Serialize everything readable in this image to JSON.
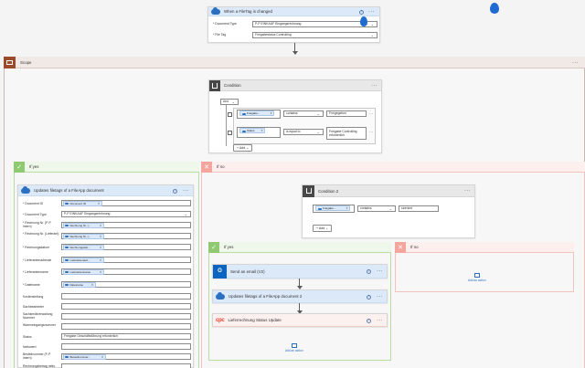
{
  "trigger": {
    "title": "When a FileTag is changed",
    "fields": [
      {
        "label": "* Document Type",
        "value": "P-P EINKAUF Eingangsrechnung"
      },
      {
        "label": "* File Tag",
        "value": "Freigabestatus Controlling"
      }
    ]
  },
  "scope": {
    "title": "Scope"
  },
  "condition": {
    "title": "Condition",
    "group_operator": "And",
    "rows": [
      {
        "token": "Freigabe...",
        "operator": "contains",
        "value": "Freigegeben"
      },
      {
        "token": "Status",
        "operator": "is equal to",
        "value": "Freigabe Controlling erforderlich"
      }
    ],
    "add_label": "Add"
  },
  "if_yes": {
    "title": "If yes",
    "update_card": {
      "title": "Updates filetags of a FileApp document",
      "fields": [
        {
          "label": "* Document ID",
          "token": "Document ID"
        },
        {
          "label": "* Document Type",
          "value": "P-P EINKAUF Eingangsrechnung"
        },
        {
          "label": "* Rechnung Nr. (P-P intern)",
          "token": "Rechnung Nr. (..."
        },
        {
          "label": "* Rechnung Nr. (Lieferant)",
          "token": "Rechnung Nr. (..."
        },
        {
          "label": "* Rechnungsdatum",
          "token": "Rechnungsdat..."
        },
        {
          "label": "* Lieferantenadresse",
          "token": "Lieferantenadr..."
        },
        {
          "label": "* Lieferantenname",
          "token": "Lieferantenname"
        },
        {
          "label": "* Dateiname",
          "token": "Dateiname"
        },
        {
          "label": "Kostenstellung",
          "value": ""
        },
        {
          "label": "Sachbearbeiter",
          "value": ""
        },
        {
          "label": "Sachkreditverwaltung Nummer",
          "value": ""
        },
        {
          "label": "Wareneingangsnummer",
          "value": ""
        },
        {
          "label": "Status",
          "value": "Freigabe Geschäftsführung erforderlich"
        },
        {
          "label": "Nettowert",
          "value": ""
        },
        {
          "label": "Bestellnummer (P-P intern)",
          "token": "Bestellnummer..."
        },
        {
          "label": "Rechnungsbetrag netto",
          "value": ""
        }
      ]
    }
  },
  "if_no": {
    "title": "If no",
    "condition2": {
      "title": "Condition 2",
      "row": {
        "token": "Freigabe...",
        "operator": "contains",
        "value": "storniert"
      },
      "add_label": "Add"
    },
    "inner_yes": {
      "title": "If yes",
      "actions": [
        {
          "title": "Send an email (V2)"
        },
        {
          "title": "Updates filetags of a FileApp document 2"
        },
        {
          "title": "Lieferrechnung Status Update"
        }
      ],
      "add_action": "Add an action"
    },
    "inner_no": {
      "title": "If no",
      "add_action": "Add an action"
    }
  },
  "colors": {
    "yes_green": "#8fca72",
    "no_red": "#f3a59e",
    "scope_brown": "#9b4b2b",
    "outlook_blue": "#0b64c0",
    "pdf_red": "#e53e2e",
    "flow_blue": "#2b6fc1"
  }
}
